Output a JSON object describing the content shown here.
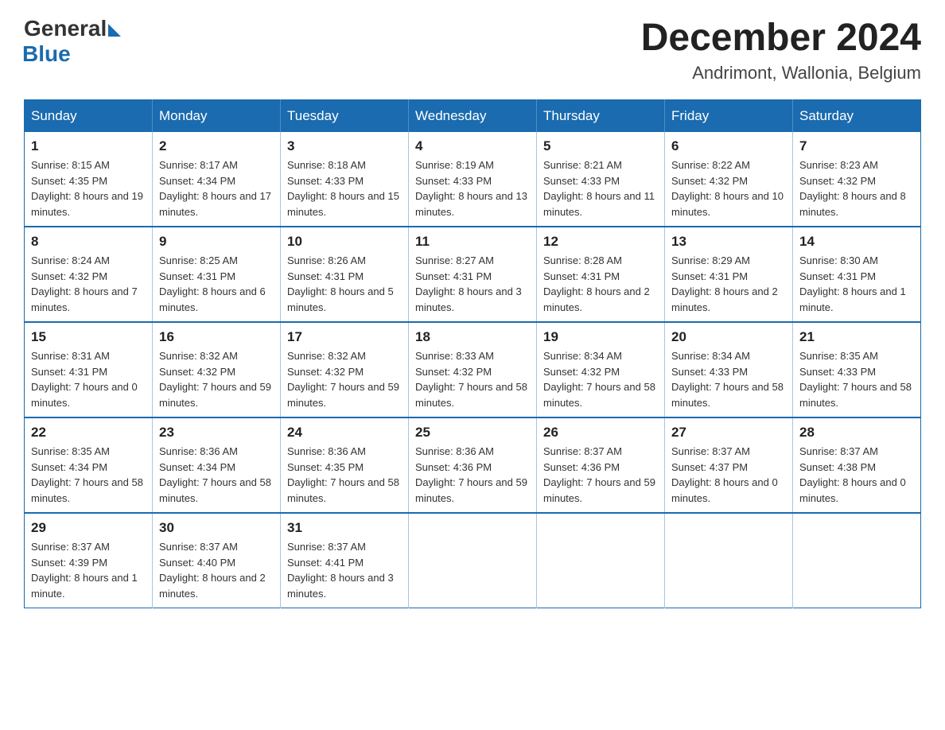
{
  "logo": {
    "general": "General",
    "blue": "Blue"
  },
  "title": "December 2024",
  "location": "Andrimont, Wallonia, Belgium",
  "weekdays": [
    "Sunday",
    "Monday",
    "Tuesday",
    "Wednesday",
    "Thursday",
    "Friday",
    "Saturday"
  ],
  "weeks": [
    [
      {
        "day": "1",
        "sunrise": "8:15 AM",
        "sunset": "4:35 PM",
        "daylight": "8 hours and 19 minutes."
      },
      {
        "day": "2",
        "sunrise": "8:17 AM",
        "sunset": "4:34 PM",
        "daylight": "8 hours and 17 minutes."
      },
      {
        "day": "3",
        "sunrise": "8:18 AM",
        "sunset": "4:33 PM",
        "daylight": "8 hours and 15 minutes."
      },
      {
        "day": "4",
        "sunrise": "8:19 AM",
        "sunset": "4:33 PM",
        "daylight": "8 hours and 13 minutes."
      },
      {
        "day": "5",
        "sunrise": "8:21 AM",
        "sunset": "4:33 PM",
        "daylight": "8 hours and 11 minutes."
      },
      {
        "day": "6",
        "sunrise": "8:22 AM",
        "sunset": "4:32 PM",
        "daylight": "8 hours and 10 minutes."
      },
      {
        "day": "7",
        "sunrise": "8:23 AM",
        "sunset": "4:32 PM",
        "daylight": "8 hours and 8 minutes."
      }
    ],
    [
      {
        "day": "8",
        "sunrise": "8:24 AM",
        "sunset": "4:32 PM",
        "daylight": "8 hours and 7 minutes."
      },
      {
        "day": "9",
        "sunrise": "8:25 AM",
        "sunset": "4:31 PM",
        "daylight": "8 hours and 6 minutes."
      },
      {
        "day": "10",
        "sunrise": "8:26 AM",
        "sunset": "4:31 PM",
        "daylight": "8 hours and 5 minutes."
      },
      {
        "day": "11",
        "sunrise": "8:27 AM",
        "sunset": "4:31 PM",
        "daylight": "8 hours and 3 minutes."
      },
      {
        "day": "12",
        "sunrise": "8:28 AM",
        "sunset": "4:31 PM",
        "daylight": "8 hours and 2 minutes."
      },
      {
        "day": "13",
        "sunrise": "8:29 AM",
        "sunset": "4:31 PM",
        "daylight": "8 hours and 2 minutes."
      },
      {
        "day": "14",
        "sunrise": "8:30 AM",
        "sunset": "4:31 PM",
        "daylight": "8 hours and 1 minute."
      }
    ],
    [
      {
        "day": "15",
        "sunrise": "8:31 AM",
        "sunset": "4:31 PM",
        "daylight": "7 hours and 0 minutes."
      },
      {
        "day": "16",
        "sunrise": "8:32 AM",
        "sunset": "4:32 PM",
        "daylight": "7 hours and 59 minutes."
      },
      {
        "day": "17",
        "sunrise": "8:32 AM",
        "sunset": "4:32 PM",
        "daylight": "7 hours and 59 minutes."
      },
      {
        "day": "18",
        "sunrise": "8:33 AM",
        "sunset": "4:32 PM",
        "daylight": "7 hours and 58 minutes."
      },
      {
        "day": "19",
        "sunrise": "8:34 AM",
        "sunset": "4:32 PM",
        "daylight": "7 hours and 58 minutes."
      },
      {
        "day": "20",
        "sunrise": "8:34 AM",
        "sunset": "4:33 PM",
        "daylight": "7 hours and 58 minutes."
      },
      {
        "day": "21",
        "sunrise": "8:35 AM",
        "sunset": "4:33 PM",
        "daylight": "7 hours and 58 minutes."
      }
    ],
    [
      {
        "day": "22",
        "sunrise": "8:35 AM",
        "sunset": "4:34 PM",
        "daylight": "7 hours and 58 minutes."
      },
      {
        "day": "23",
        "sunrise": "8:36 AM",
        "sunset": "4:34 PM",
        "daylight": "7 hours and 58 minutes."
      },
      {
        "day": "24",
        "sunrise": "8:36 AM",
        "sunset": "4:35 PM",
        "daylight": "7 hours and 58 minutes."
      },
      {
        "day": "25",
        "sunrise": "8:36 AM",
        "sunset": "4:36 PM",
        "daylight": "7 hours and 59 minutes."
      },
      {
        "day": "26",
        "sunrise": "8:37 AM",
        "sunset": "4:36 PM",
        "daylight": "7 hours and 59 minutes."
      },
      {
        "day": "27",
        "sunrise": "8:37 AM",
        "sunset": "4:37 PM",
        "daylight": "8 hours and 0 minutes."
      },
      {
        "day": "28",
        "sunrise": "8:37 AM",
        "sunset": "4:38 PM",
        "daylight": "8 hours and 0 minutes."
      }
    ],
    [
      {
        "day": "29",
        "sunrise": "8:37 AM",
        "sunset": "4:39 PM",
        "daylight": "8 hours and 1 minute."
      },
      {
        "day": "30",
        "sunrise": "8:37 AM",
        "sunset": "4:40 PM",
        "daylight": "8 hours and 2 minutes."
      },
      {
        "day": "31",
        "sunrise": "8:37 AM",
        "sunset": "4:41 PM",
        "daylight": "8 hours and 3 minutes."
      },
      null,
      null,
      null,
      null
    ]
  ]
}
